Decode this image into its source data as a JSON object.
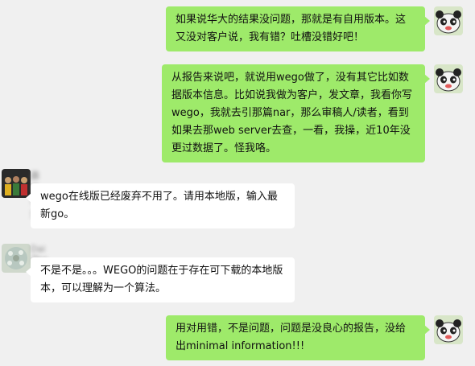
{
  "messages": [
    {
      "side": "right",
      "text": "如果说华大的结果没问题，那就是有自用版本。这又没对客户说，我有错？吐槽没错好吧！"
    },
    {
      "side": "right",
      "text": "从报告来说吧，就说用wego做了，没有其它比如数据版本信息。比如说我做为客户，发文章，我看你写wego，我就去引那篇nar，那么审稿人/读者，看到如果去那web server去查，一看，我操，近10年没更过数据了。怪我咯。"
    },
    {
      "side": "left",
      "sender": "霹雳 玛盟",
      "text": "wego在线版已经废弃不用了。请用本地版，输入最新go。"
    },
    {
      "side": "left",
      "sender": "Dai Zha",
      "text": "不是不是。。。WEGO的问题在于存在可下载的本地版本，可以理解为一个算法。"
    },
    {
      "side": "right",
      "text": "用对用错，不是问题，问题是没良心的报告，没给出minimal information!!!"
    }
  ],
  "colors": {
    "background": "#f0f0f0",
    "outgoing_bubble": "#9eea6a",
    "incoming_bubble": "#ffffff"
  }
}
